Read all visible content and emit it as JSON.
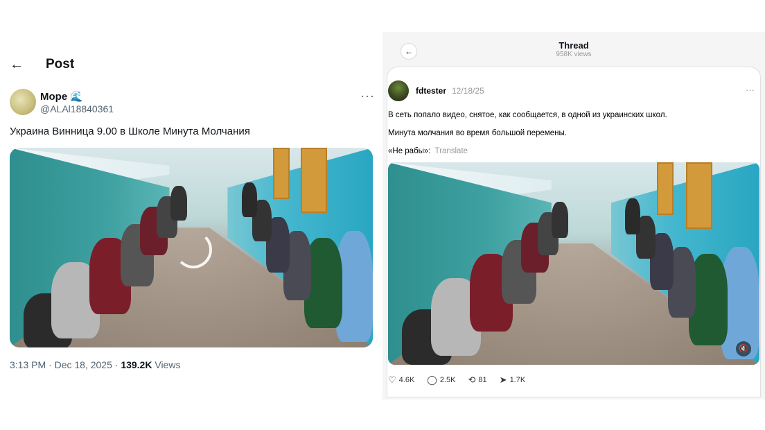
{
  "left": {
    "header": {
      "back_icon": "arrow-left-icon",
      "title": "Post"
    },
    "author": {
      "name": "Море",
      "emoji": "🌊",
      "handle": "@ALAl18840361"
    },
    "more_icon": "more-icon",
    "text": "Украина Винница 9.00 в Школе Минута Молчания",
    "meta": {
      "time": "3:13 PM · Dec 18, 2025 · ",
      "views_count": "139.2K",
      "views_label": " Views"
    }
  },
  "right": {
    "header": {
      "back_icon": "arrow-left-icon",
      "title": "Thread",
      "views": "958K views"
    },
    "author": {
      "name": "fdtester",
      "date": "12/18/25"
    },
    "more_icon": "more-icon",
    "text1": "В сеть попало видео, снятое, как сообщается, в одной из украинских школ.",
    "text2": "Минута молчания во время большой перемены.",
    "text3": "«Не рабы»:",
    "translate": "Translate",
    "mute_icon": "speaker-muted-icon",
    "actions": {
      "likes": "4.6K",
      "comments": "2.5K",
      "reposts": "81",
      "shares": "1.7K"
    }
  }
}
